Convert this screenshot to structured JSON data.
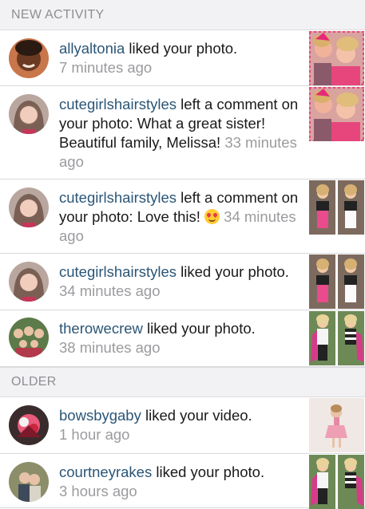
{
  "sections": {
    "new_activity": "NEW ACTIVITY",
    "older": "OLDER"
  },
  "notifications": [
    {
      "user": "allyaltonia",
      "text": " liked your photo.",
      "time": "7 minutes ago"
    },
    {
      "user": "cutegirlshairstyles",
      "text": " left a comment on your photo: What a great sister! Beautiful family, Melissa!",
      "time": "33 minutes ago"
    },
    {
      "user": "cutegirlshairstyles",
      "text": " left a comment on your photo: Love this! ",
      "time": "34 minutes ago",
      "emoji": "heart-eyes-emoji"
    },
    {
      "user": "cutegirlshairstyles",
      "text": " liked your photo.",
      "time": "34 minutes ago"
    },
    {
      "user": "therowecrew",
      "text": " liked your photo.",
      "time": "38 minutes ago"
    },
    {
      "user": "bowsbygaby",
      "text": " liked your video.",
      "time": "1 hour ago"
    },
    {
      "user": "courtneyrakes",
      "text": " liked your photo.",
      "time": "3 hours ago"
    }
  ],
  "colors": {
    "username": "#2b5677",
    "timestamp": "#9b9b9f",
    "section_bg": "#f2f2f4",
    "section_text": "#8e8e93"
  }
}
